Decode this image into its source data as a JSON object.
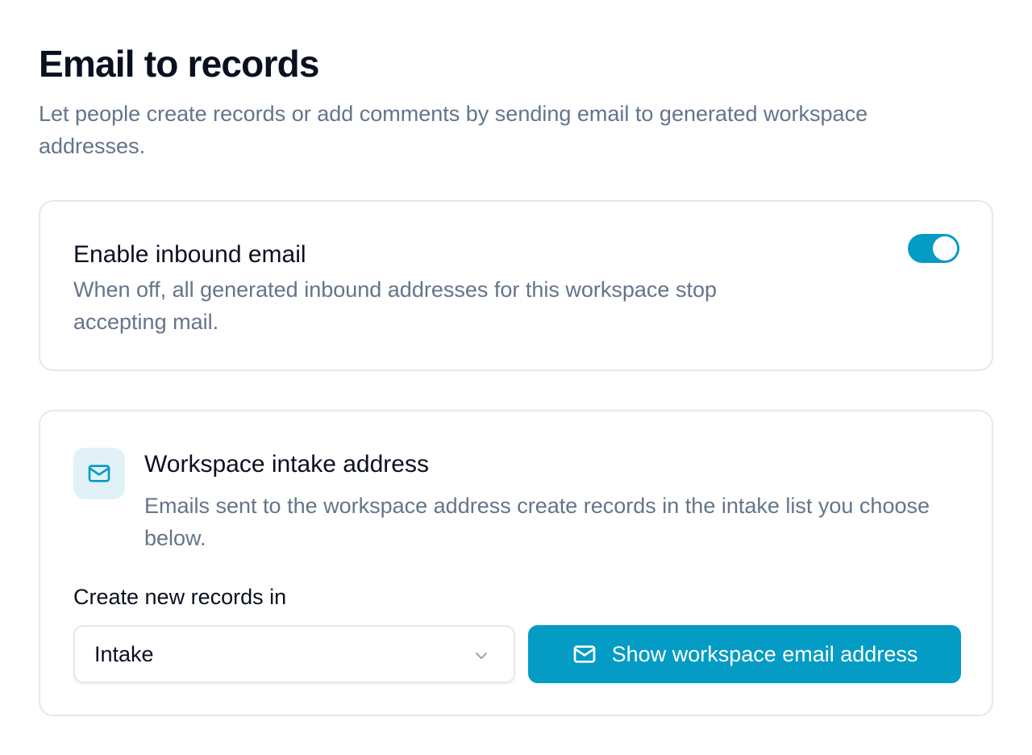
{
  "header": {
    "title": "Email to records",
    "description": "Let people create records or add comments by sending email to generated workspace addresses."
  },
  "enable_card": {
    "title": "Enable inbound email",
    "description": "When off, all generated inbound addresses for this workspace stop accepting mail.",
    "toggle_on": true
  },
  "intake_card": {
    "icon": "mail-icon",
    "title": "Workspace intake address",
    "description": "Emails sent to the workspace address create records in the intake list you choose below.",
    "field_label": "Create new records in",
    "select_value": "Intake",
    "button_label": "Show workspace email address",
    "button_icon": "mail-icon"
  },
  "colors": {
    "accent": "#049cc4",
    "icon_bg": "#e0f2f8",
    "muted_text": "#64748b",
    "border": "#e2e8f0"
  }
}
